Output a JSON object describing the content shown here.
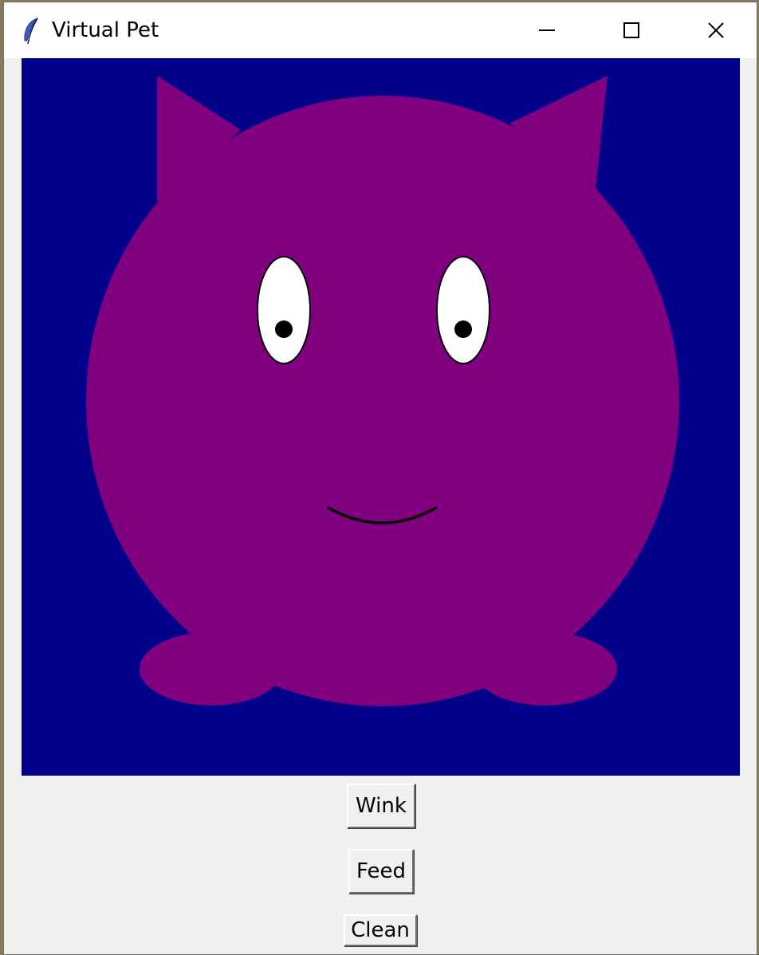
{
  "window": {
    "title": "Virtual Pet",
    "icon": "feather-icon",
    "controls": [
      "minimize-icon",
      "maximize-icon",
      "close-icon"
    ]
  },
  "canvas": {
    "background_color": "#00008b",
    "pet_body_color": "#800080",
    "eye_color": "#ffffff",
    "pupil_color": "#000000",
    "mouth_color": "#000000"
  },
  "buttons": {
    "wink": "Wink",
    "feed": "Feed",
    "clean": "Clean"
  }
}
